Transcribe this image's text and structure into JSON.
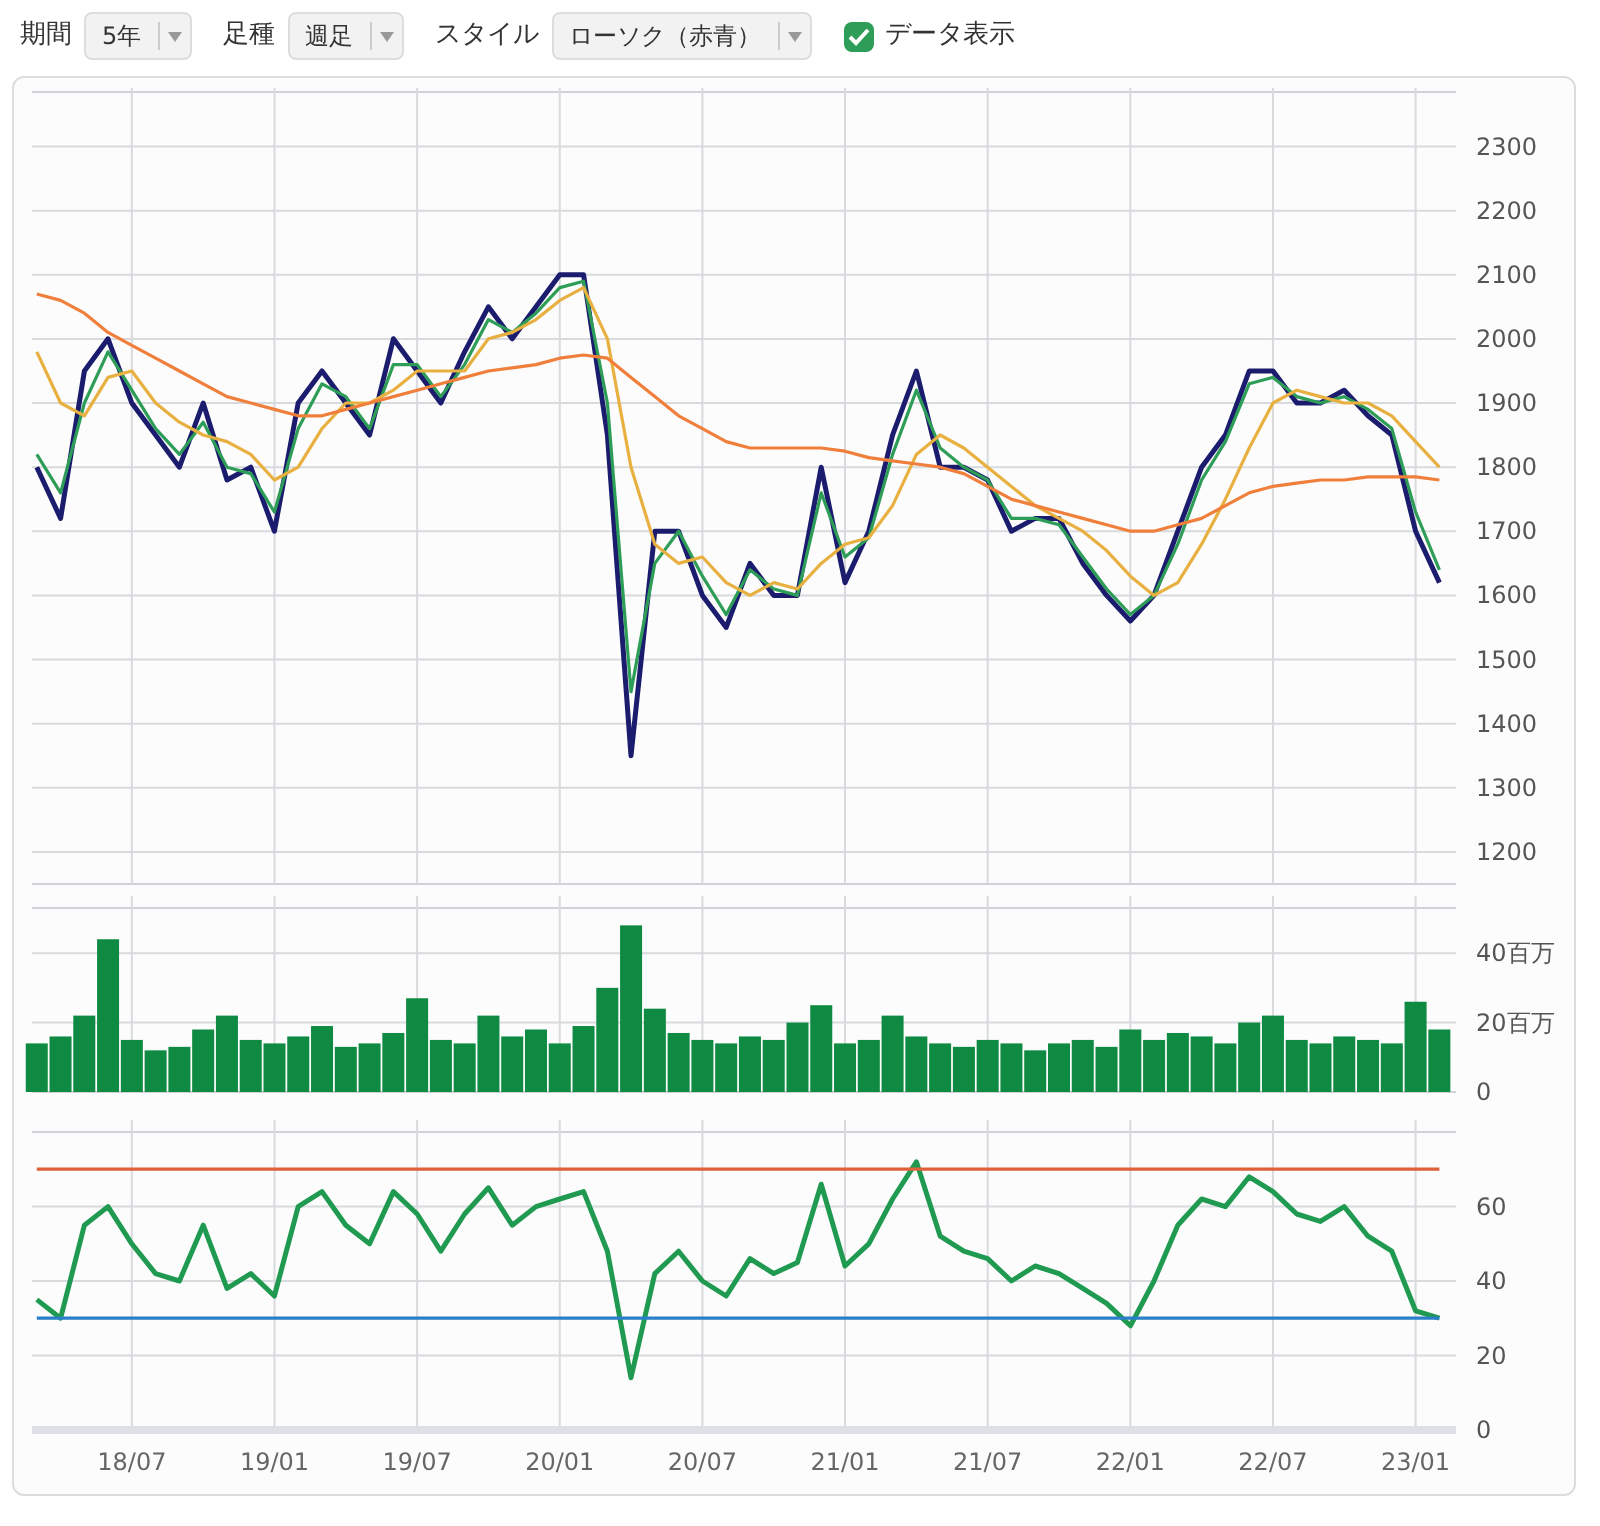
{
  "toolbar": {
    "controls": [
      {
        "kind": "select",
        "label": "期間",
        "value": "5年"
      },
      {
        "kind": "select",
        "label": "足種",
        "value": "週足"
      },
      {
        "kind": "select",
        "label": "スタイル",
        "value": "ローソク（赤青）"
      },
      {
        "kind": "checkbox",
        "label": "データ表示",
        "checked": true
      }
    ]
  },
  "price_chart": {
    "chart_data": {
      "type": "line",
      "grid": true,
      "ylim": [
        1150,
        2385
      ],
      "yticks": [
        1200,
        1300,
        1400,
        1500,
        1600,
        1700,
        1800,
        1900,
        2000,
        2100,
        2200,
        2300
      ],
      "series": [
        {
          "color": "#1c1c6e",
          "values": [
            1800,
            1720,
            1950,
            2000,
            1900,
            1850,
            1800,
            1900,
            1780,
            1800,
            1700,
            1900,
            1950,
            1900,
            1850,
            2000,
            1950,
            1900,
            1980,
            2050,
            2000,
            2050,
            2100,
            2100,
            1850,
            1350,
            1700,
            1700,
            1600,
            1550,
            1650,
            1600,
            1600,
            1800,
            1620,
            1700,
            1850,
            1950,
            1800,
            1800,
            1780,
            1700,
            1720,
            1720,
            1650,
            1600,
            1560,
            1600,
            1700,
            1800,
            1850,
            1950,
            1950,
            1900,
            1900,
            1920,
            1880,
            1850,
            1700,
            1620
          ]
        },
        {
          "color": "#2e9d57",
          "values": [
            1820,
            1760,
            1900,
            1980,
            1920,
            1860,
            1820,
            1870,
            1800,
            1790,
            1730,
            1860,
            1930,
            1910,
            1860,
            1960,
            1960,
            1910,
            1960,
            2030,
            2010,
            2040,
            2080,
            2090,
            1900,
            1450,
            1650,
            1700,
            1630,
            1570,
            1640,
            1610,
            1600,
            1760,
            1660,
            1690,
            1820,
            1920,
            1830,
            1800,
            1780,
            1720,
            1720,
            1710,
            1660,
            1610,
            1570,
            1600,
            1680,
            1780,
            1840,
            1930,
            1940,
            1910,
            1900,
            1910,
            1890,
            1860,
            1730,
            1640
          ]
        },
        {
          "color": "#e8b040",
          "values": [
            1980,
            1900,
            1880,
            1940,
            1950,
            1900,
            1870,
            1850,
            1840,
            1820,
            1780,
            1800,
            1860,
            1900,
            1900,
            1920,
            1950,
            1950,
            1950,
            2000,
            2010,
            2030,
            2060,
            2080,
            2000,
            1800,
            1680,
            1650,
            1660,
            1620,
            1600,
            1620,
            1610,
            1650,
            1680,
            1690,
            1740,
            1820,
            1850,
            1830,
            1800,
            1770,
            1740,
            1720,
            1700,
            1670,
            1630,
            1600,
            1620,
            1680,
            1750,
            1830,
            1900,
            1920,
            1910,
            1900,
            1900,
            1880,
            1840,
            1800
          ]
        },
        {
          "color": "#f07f3c",
          "values": [
            2070,
            2060,
            2040,
            2010,
            1990,
            1970,
            1950,
            1930,
            1910,
            1900,
            1890,
            1880,
            1880,
            1890,
            1900,
            1910,
            1920,
            1930,
            1940,
            1950,
            1955,
            1960,
            1970,
            1975,
            1970,
            1940,
            1910,
            1880,
            1860,
            1840,
            1830,
            1830,
            1830,
            1830,
            1825,
            1815,
            1810,
            1805,
            1800,
            1790,
            1770,
            1750,
            1740,
            1730,
            1720,
            1710,
            1700,
            1700,
            1710,
            1720,
            1740,
            1760,
            1770,
            1775,
            1780,
            1780,
            1785,
            1785,
            1785,
            1780
          ]
        }
      ]
    }
  },
  "volume_chart": {
    "chart_data": {
      "type": "bar",
      "grid": true,
      "ylim": [
        0,
        53
      ],
      "yticks": [
        0,
        {
          "value": 20,
          "label": "20百万"
        },
        {
          "value": 40,
          "label": "40百万"
        }
      ],
      "series": [
        {
          "color": "#0e8a42",
          "values": [
            14,
            16,
            22,
            44,
            15,
            12,
            13,
            18,
            22,
            15,
            14,
            16,
            19,
            13,
            14,
            17,
            27,
            15,
            14,
            22,
            16,
            18,
            14,
            19,
            30,
            48,
            24,
            17,
            15,
            14,
            16,
            15,
            20,
            25,
            14,
            15,
            22,
            16,
            14,
            13,
            15,
            14,
            12,
            14,
            15,
            13,
            18,
            15,
            17,
            16,
            14,
            20,
            22,
            15,
            14,
            16,
            15,
            14,
            26,
            18
          ]
        }
      ]
    }
  },
  "rsi_chart": {
    "chart_data": {
      "type": "line",
      "grid": true,
      "ylim": [
        0,
        80
      ],
      "yticks": [
        0,
        20,
        40,
        60
      ],
      "categories": [
        null,
        null,
        null,
        null,
        "18/07",
        null,
        null,
        null,
        null,
        null,
        "19/01",
        null,
        null,
        null,
        null,
        null,
        "19/07",
        null,
        null,
        null,
        null,
        null,
        "20/01",
        null,
        null,
        null,
        null,
        null,
        "20/07",
        null,
        null,
        null,
        null,
        null,
        "21/01",
        null,
        null,
        null,
        null,
        null,
        "21/07",
        null,
        null,
        null,
        null,
        null,
        "22/01",
        null,
        null,
        null,
        null,
        null,
        "22/07",
        null,
        null,
        null,
        null,
        null,
        "23/01",
        null
      ],
      "series": [
        {
          "color": "#1f9a50",
          "values": [
            35,
            30,
            55,
            60,
            50,
            42,
            40,
            55,
            38,
            42,
            36,
            60,
            64,
            55,
            50,
            64,
            58,
            48,
            58,
            65,
            55,
            60,
            62,
            64,
            48,
            14,
            42,
            48,
            40,
            36,
            46,
            42,
            45,
            66,
            44,
            50,
            62,
            72,
            52,
            48,
            46,
            40,
            44,
            42,
            38,
            34,
            28,
            40,
            55,
            62,
            60,
            68,
            64,
            58,
            56,
            60,
            52,
            48,
            32,
            30
          ]
        },
        {
          "color": "#e0603a",
          "values": [
            70,
            70,
            70,
            70,
            70,
            70,
            70,
            70,
            70,
            70,
            70,
            70,
            70,
            70,
            70,
            70,
            70,
            70,
            70,
            70,
            70,
            70,
            70,
            70,
            70,
            70,
            70,
            70,
            70,
            70,
            70,
            70,
            70,
            70,
            70,
            70,
            70,
            70,
            70,
            70,
            70,
            70,
            70,
            70,
            70,
            70,
            70,
            70,
            70,
            70,
            70,
            70,
            70,
            70,
            70,
            70,
            70,
            70,
            70,
            70
          ]
        },
        {
          "color": "#2a7fc8",
          "values": [
            30,
            30,
            30,
            30,
            30,
            30,
            30,
            30,
            30,
            30,
            30,
            30,
            30,
            30,
            30,
            30,
            30,
            30,
            30,
            30,
            30,
            30,
            30,
            30,
            30,
            30,
            30,
            30,
            30,
            30,
            30,
            30,
            30,
            30,
            30,
            30,
            30,
            30,
            30,
            30,
            30,
            30,
            30,
            30,
            30,
            30,
            30,
            30,
            30,
            30,
            30,
            30,
            30,
            30,
            30,
            30,
            30,
            30,
            30,
            30
          ]
        }
      ]
    }
  }
}
